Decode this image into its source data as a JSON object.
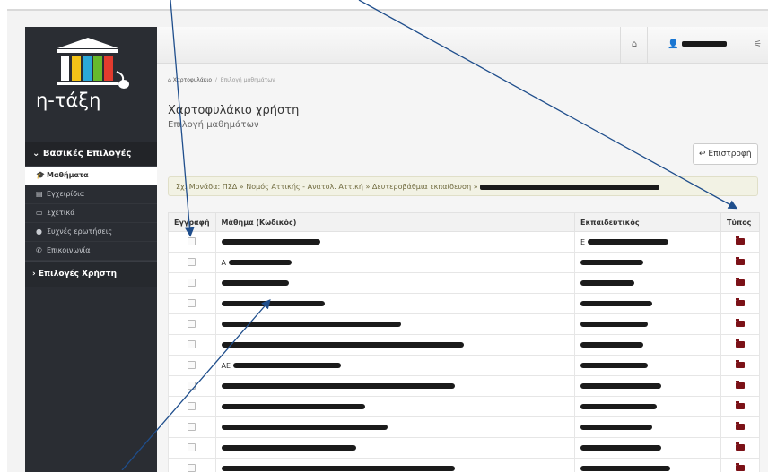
{
  "sidebar": {
    "logo_text": "η-τάξη",
    "header": "Βασικές Επιλογές",
    "items": [
      {
        "label": "Μαθήματα",
        "icon": "graduation-cap-icon",
        "active": true
      },
      {
        "label": "Εγχειρίδια",
        "icon": "book-icon",
        "active": false
      },
      {
        "label": "Σχετικά",
        "icon": "credit-card-icon",
        "active": false
      },
      {
        "label": "Συχνές ερωτήσεις",
        "icon": "question-circle-icon",
        "active": false
      },
      {
        "label": "Επικοινωνία",
        "icon": "phone-icon",
        "active": false
      }
    ],
    "footer": "Επιλογές Χρήστη"
  },
  "topbar": {
    "home_icon": "home-icon",
    "user_icon": "user-icon",
    "settings_icon": "sliders-icon"
  },
  "breadcrumb": {
    "home": "Χαρτοφυλάκιο",
    "current": "Επιλογή μαθημάτων"
  },
  "page": {
    "title": "Χαρτοφυλάκιο χρήστη",
    "subtitle": "Επιλογή μαθημάτων",
    "back_label": "Επιστροφή"
  },
  "alert": {
    "text": "Σχ. Μονάδα: ΠΣΔ » Νομός Αττικής - Ανατολ. Αττική » Δευτεροβάθμια εκπαίδευση »"
  },
  "table": {
    "headers": [
      "Εγγραφή",
      "Μάθημα (Κωδικός)",
      "Εκπαιδευτικός",
      "Τύπος"
    ],
    "rows": [
      {
        "course": "",
        "teacher": "Ε"
      },
      {
        "course": "Α",
        "teacher": ""
      },
      {
        "course": "",
        "teacher": ""
      },
      {
        "course": "",
        "teacher": ""
      },
      {
        "course": "",
        "teacher": ""
      },
      {
        "course": "",
        "teacher": ""
      },
      {
        "course": "ΑΕ",
        "teacher": ""
      },
      {
        "course": "",
        "teacher": ""
      },
      {
        "course": "",
        "teacher": ""
      },
      {
        "course": "",
        "teacher": ""
      },
      {
        "course": "",
        "teacher": ""
      },
      {
        "course": "",
        "teacher": ""
      }
    ]
  },
  "colors": {
    "sidebar_bg": "#2a2d33",
    "accent": "#7b1117"
  }
}
